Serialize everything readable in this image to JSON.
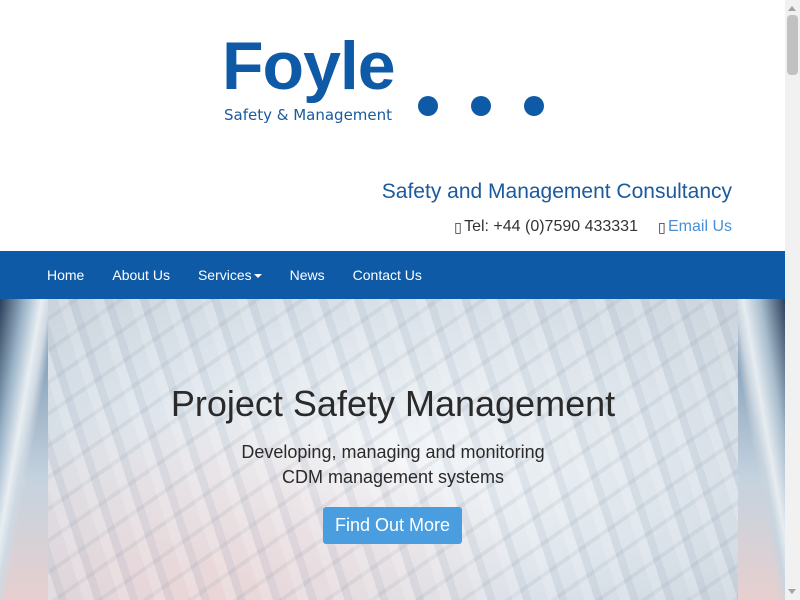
{
  "logo": {
    "word": "Foyle",
    "tagline": "Safety & Management"
  },
  "header": {
    "tagline": "Safety and Management Consultancy",
    "phone_icon": "phone-icon",
    "phone": "Tel: +44 (0)7590 433331",
    "email_icon": "envelope-icon",
    "email": "Email Us"
  },
  "nav": {
    "items": [
      {
        "label": "Home"
      },
      {
        "label": "About Us"
      },
      {
        "label": "Services"
      },
      {
        "label": "News"
      },
      {
        "label": "Contact Us"
      }
    ]
  },
  "hero": {
    "title": "Project Safety Management",
    "subtitle_line1": "Developing, managing and monitoring",
    "subtitle_line2": "CDM management systems",
    "button": "Find Out More"
  },
  "colors": {
    "brand_blue": "#0e5aa7",
    "link_blue": "#4a8fd6",
    "button_blue": "#4a9ee0"
  }
}
